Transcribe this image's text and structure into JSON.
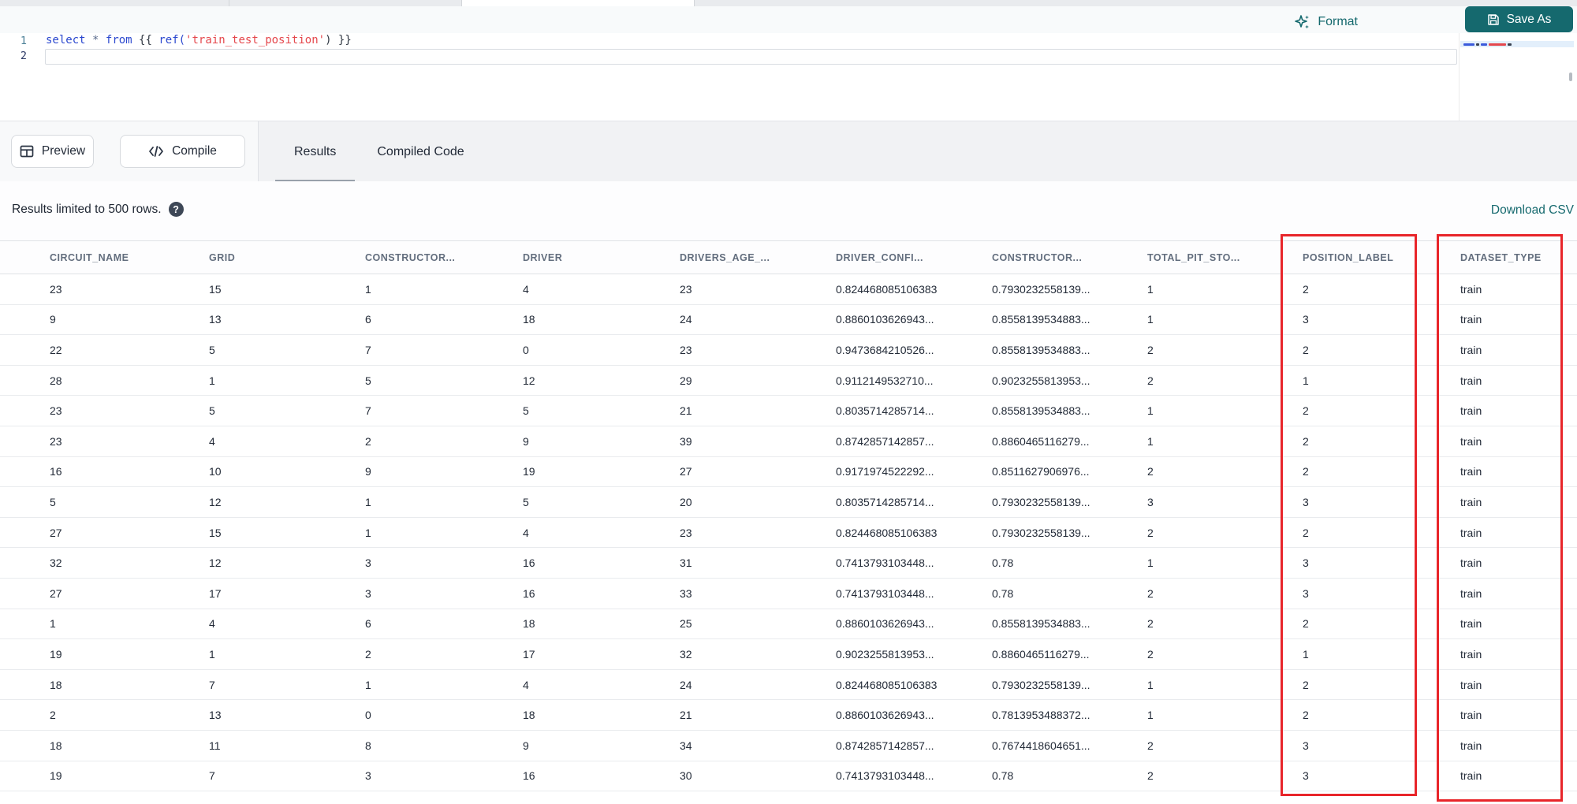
{
  "toolbar": {
    "format_label": "Format",
    "save_as_label": "Save As"
  },
  "editor": {
    "line_numbers": [
      "1",
      "2"
    ],
    "tokens": [
      {
        "text": "select",
        "type": "keyword"
      },
      {
        "text": " ",
        "type": "plain"
      },
      {
        "text": "*",
        "type": "operator"
      },
      {
        "text": " ",
        "type": "plain"
      },
      {
        "text": "from",
        "type": "keyword"
      },
      {
        "text": " {{ ",
        "type": "plain"
      },
      {
        "text": "ref(",
        "type": "keyword"
      },
      {
        "text": "'train_test_position'",
        "type": "string"
      },
      {
        "text": ")",
        "type": "plain"
      },
      {
        "text": " }}",
        "type": "plain"
      }
    ]
  },
  "actions": {
    "preview_label": "Preview",
    "compile_label": "Compile"
  },
  "tabs": [
    {
      "label": "Results",
      "active": true
    },
    {
      "label": "Compiled Code",
      "active": false
    }
  ],
  "results_bar": {
    "info": "Results limited to 500 rows.",
    "help_icon": "question-mark",
    "download_label": "Download CSV"
  },
  "table": {
    "columns": [
      "CIRCUIT_NAME",
      "GRID",
      "CONSTRUCTOR...",
      "DRIVER",
      "DRIVERS_AGE_...",
      "DRIVER_CONFI...",
      "CONSTRUCTOR...",
      "TOTAL_PIT_STO...",
      "POSITION_LABEL",
      "DATASET_TYPE"
    ],
    "rows": [
      [
        "23",
        "15",
        "1",
        "4",
        "23",
        "0.824468085106383",
        "0.7930232558139...",
        "1",
        "2",
        "train"
      ],
      [
        "9",
        "13",
        "6",
        "18",
        "24",
        "0.8860103626943...",
        "0.8558139534883...",
        "1",
        "3",
        "train"
      ],
      [
        "22",
        "5",
        "7",
        "0",
        "23",
        "0.9473684210526...",
        "0.8558139534883...",
        "2",
        "2",
        "train"
      ],
      [
        "28",
        "1",
        "5",
        "12",
        "29",
        "0.9112149532710...",
        "0.9023255813953...",
        "2",
        "1",
        "train"
      ],
      [
        "23",
        "5",
        "7",
        "5",
        "21",
        "0.8035714285714...",
        "0.8558139534883...",
        "1",
        "2",
        "train"
      ],
      [
        "23",
        "4",
        "2",
        "9",
        "39",
        "0.8742857142857...",
        "0.8860465116279...",
        "1",
        "2",
        "train"
      ],
      [
        "16",
        "10",
        "9",
        "19",
        "27",
        "0.9171974522292...",
        "0.8511627906976...",
        "2",
        "2",
        "train"
      ],
      [
        "5",
        "12",
        "1",
        "5",
        "20",
        "0.8035714285714...",
        "0.7930232558139...",
        "3",
        "3",
        "train"
      ],
      [
        "27",
        "15",
        "1",
        "4",
        "23",
        "0.824468085106383",
        "0.7930232558139...",
        "2",
        "2",
        "train"
      ],
      [
        "32",
        "12",
        "3",
        "16",
        "31",
        "0.7413793103448...",
        "0.78",
        "1",
        "3",
        "train"
      ],
      [
        "27",
        "17",
        "3",
        "16",
        "33",
        "0.7413793103448...",
        "0.78",
        "2",
        "3",
        "train"
      ],
      [
        "1",
        "4",
        "6",
        "18",
        "25",
        "0.8860103626943...",
        "0.8558139534883...",
        "2",
        "2",
        "train"
      ],
      [
        "19",
        "1",
        "2",
        "17",
        "32",
        "0.9023255813953...",
        "0.8860465116279...",
        "2",
        "1",
        "train"
      ],
      [
        "18",
        "7",
        "1",
        "4",
        "24",
        "0.824468085106383",
        "0.7930232558139...",
        "1",
        "2",
        "train"
      ],
      [
        "2",
        "13",
        "0",
        "18",
        "21",
        "0.8860103626943...",
        "0.7813953488372...",
        "1",
        "2",
        "train"
      ],
      [
        "18",
        "11",
        "8",
        "9",
        "34",
        "0.8742857142857...",
        "0.7674418604651...",
        "2",
        "3",
        "train"
      ],
      [
        "19",
        "7",
        "3",
        "16",
        "30",
        "0.7413793103448...",
        "0.78",
        "2",
        "3",
        "train"
      ]
    ],
    "annotated_columns": [
      "POSITION_LABEL",
      "DATASET_TYPE"
    ]
  },
  "colors": {
    "accent_teal": "#15696e",
    "annotation_red": "#e8252a"
  }
}
